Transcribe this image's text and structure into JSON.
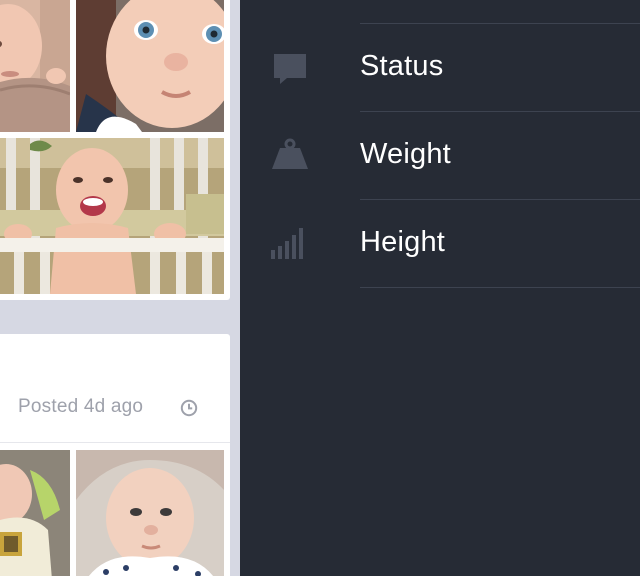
{
  "feed": {
    "post_meta": {
      "posted_label": "Posted 4d ago",
      "icon": "clock-icon"
    }
  },
  "menu": {
    "items": [
      {
        "label": "Status",
        "icon": "speech-bubble-icon"
      },
      {
        "label": "Weight",
        "icon": "weight-icon"
      },
      {
        "label": "Height",
        "icon": "height-bars-icon"
      }
    ]
  },
  "colors": {
    "menu_background": "#262b35",
    "menu_divider": "#3d4350",
    "menu_icon": "#4a505e",
    "feed_background": "#d6d8e3",
    "card_background": "#ffffff",
    "meta_text": "#9ea1ab"
  }
}
